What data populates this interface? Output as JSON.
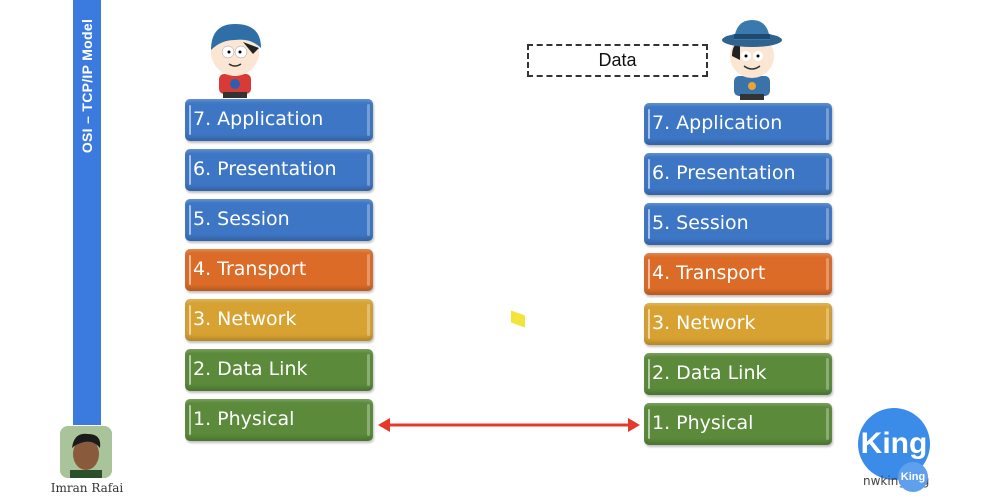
{
  "sidebar": {
    "title": "OSI – TCP/IP Model"
  },
  "left_stack": {
    "layers": [
      {
        "label": "7. Application",
        "color": "#3d76c4"
      },
      {
        "label": "6. Presentation",
        "color": "#3d76c4"
      },
      {
        "label": "5. Session",
        "color": "#3d76c4"
      },
      {
        "label": "4. Transport",
        "color": "#dc6b28"
      },
      {
        "label": "3. Network",
        "color": "#d7a232"
      },
      {
        "label": "2. Data Link",
        "color": "#5b8a3a"
      },
      {
        "label": "1. Physical",
        "color": "#5b8a3a"
      }
    ]
  },
  "right_stack": {
    "layers": [
      {
        "label": "7. Application",
        "color": "#3d76c4"
      },
      {
        "label": "6. Presentation",
        "color": "#3d76c4"
      },
      {
        "label": "5. Session",
        "color": "#3d76c4"
      },
      {
        "label": "4. Transport",
        "color": "#dc6b28"
      },
      {
        "label": "3. Network",
        "color": "#d7a232"
      },
      {
        "label": "2. Data Link",
        "color": "#5b8a3a"
      },
      {
        "label": "1. Physical",
        "color": "#5b8a3a"
      }
    ]
  },
  "data_box": {
    "label": "Data"
  },
  "link": {
    "color": "#e53a2a",
    "type": "bidirectional-arrow"
  },
  "author": {
    "name": "Imran Rafai"
  },
  "logo": {
    "text": "King",
    "small_text": "King",
    "url": "nwking.org"
  }
}
